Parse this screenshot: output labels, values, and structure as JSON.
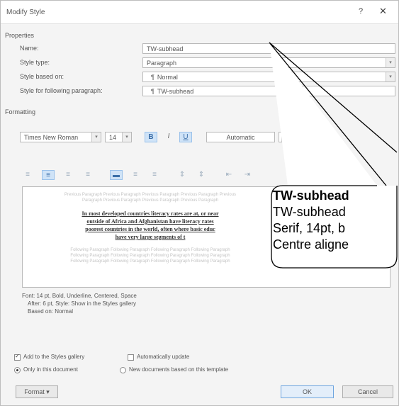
{
  "window": {
    "title": "Modify Style",
    "help_glyph": "?",
    "close_glyph": "✕"
  },
  "properties": {
    "heading": "Properties",
    "name_label": "Name:",
    "name_value": "TW-subhead",
    "style_type_label": "Style type:",
    "style_type_value": "Paragraph",
    "based_on_label": "Style based on:",
    "based_on_value": "Normal",
    "following_label": "Style for following paragraph:",
    "following_value": "TW-subhead",
    "para_glyph": "¶"
  },
  "formatting": {
    "heading": "Formatting",
    "font": "Times New Roman",
    "size": "14",
    "bold": "B",
    "italic": "I",
    "underline": "U",
    "color": "Automatic"
  },
  "preview": {
    "prev_para": [
      "Previous Paragraph Previous Paragraph Previous Paragraph Previous Paragraph Previous",
      "Paragraph Previous Paragraph Previous Paragraph Previous Paragraph"
    ],
    "sample": [
      "In most developed countries literacy rates are at, or near",
      "outside of Africa and Afghanistan have literacy rates",
      "poorest countries in the world, often where basic educ",
      "have very large segments of t"
    ],
    "next_para": [
      "Following Paragraph Following Paragraph Following Paragraph Following Paragraph",
      "Following Paragraph Following Paragraph Following Paragraph Following Paragraph",
      "Following Paragraph Following Paragraph Following Paragraph Following Paragraph"
    ]
  },
  "description": [
    "Font: 14 pt, Bold, Underline, Centered, Space",
    "After:  6 pt, Style: Show in the Styles gallery",
    "Based on: Normal"
  ],
  "options": {
    "add_gallery": "Add to the Styles gallery",
    "add_gallery_checked": true,
    "auto_update": "Automatically update",
    "auto_update_checked": false,
    "only_doc": "Only in this document",
    "new_docs": "New documents based on this template",
    "selected_scope": "only_doc"
  },
  "buttons": {
    "format": "Format ▾",
    "ok": "OK",
    "cancel": "Cancel"
  },
  "callout": {
    "title": "TW-subhead",
    "line1": "TW-subhead",
    "line2": "Serif, 14pt, b",
    "line3": "Centre aligne"
  }
}
